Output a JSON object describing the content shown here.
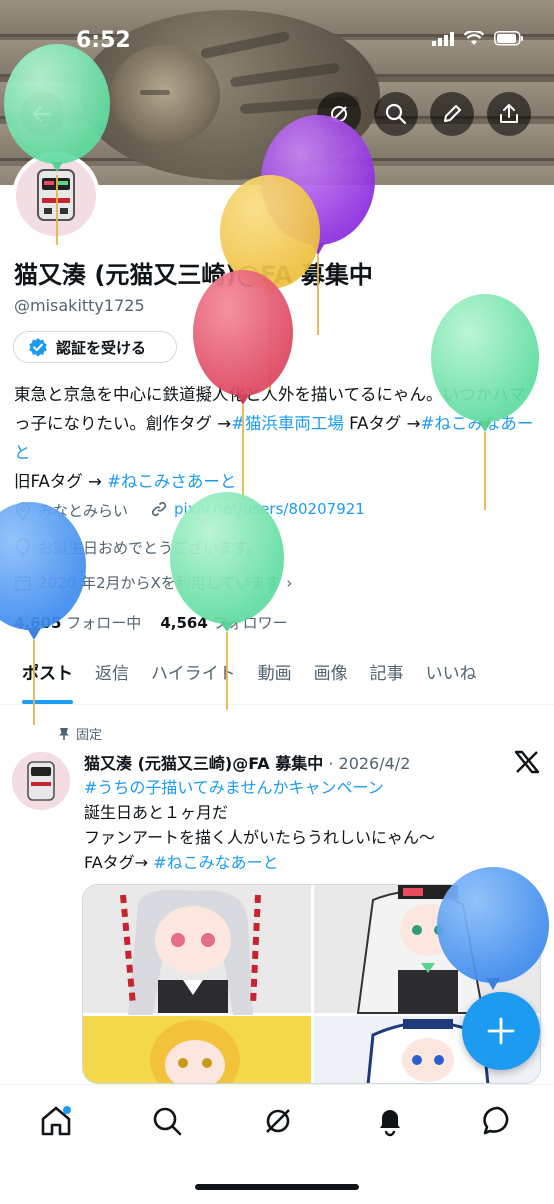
{
  "status_bar": {
    "time": "6:52"
  },
  "profile": {
    "name": "猫又湊 (元猫又三崎)@FA 募集中",
    "handle": "@misakitty1725",
    "verify_button": "認証を受ける",
    "bio": {
      "line1_text": "東急と京急を中心に鉄道擬人化と人外を描いてるにゃん。いつかハマっ子になりたい。創作タグ →",
      "tag1": "#猫浜車両工場",
      "mid": " FAタグ →",
      "tag2": "#ねこみなあーと",
      "line3_text": "旧FAタグ → ",
      "tag3": "#ねこみさあーと"
    },
    "location": "みなとみらい",
    "website": "pixiv.net/users/80207921",
    "birthday": "お誕生日おめでとうございます。",
    "joined": "2020 年2月からXを利用しています",
    "following_count": "4,605",
    "following_label": "フォロー中",
    "followers_count": "4,564",
    "followers_label": "フォロワー"
  },
  "tabs": [
    {
      "label": "ポスト",
      "active": true
    },
    {
      "label": "返信"
    },
    {
      "label": "ハイライト"
    },
    {
      "label": "動画"
    },
    {
      "label": "画像"
    },
    {
      "label": "記事"
    },
    {
      "label": "いいね"
    }
  ],
  "pinned_post": {
    "pinned_label": "固定",
    "author": "猫又湊 (元猫又三崎)@FA 募集中",
    "date": "· 2026/4/2",
    "hashtag": "#うちの子描いてみませんかキャンペーン",
    "line2": "誕生日あと１ヶ月だ",
    "line3": "ファンアートを描く人がいたらうれしいにゃん～",
    "line4_prefix": "FAタグ→ ",
    "line4_tag": "#ねこみなあーと"
  },
  "colors": {
    "accent": "#1d9bf0",
    "balloon_green": "#6fe0a9",
    "balloon_purple": "#9b3fe0",
    "balloon_yellow": "#f1c34a",
    "balloon_red": "#e4546a",
    "balloon_blue": "#4a95f0"
  },
  "icons": [
    "back-arrow-icon",
    "grok-icon",
    "search-icon",
    "edit-icon",
    "share-icon",
    "verified-badge-icon",
    "location-icon",
    "link-icon",
    "balloon-icon",
    "calendar-icon",
    "pin-icon",
    "x-logo-icon",
    "plus-icon",
    "home-icon",
    "explore-icon",
    "bell-icon",
    "chat-icon"
  ]
}
